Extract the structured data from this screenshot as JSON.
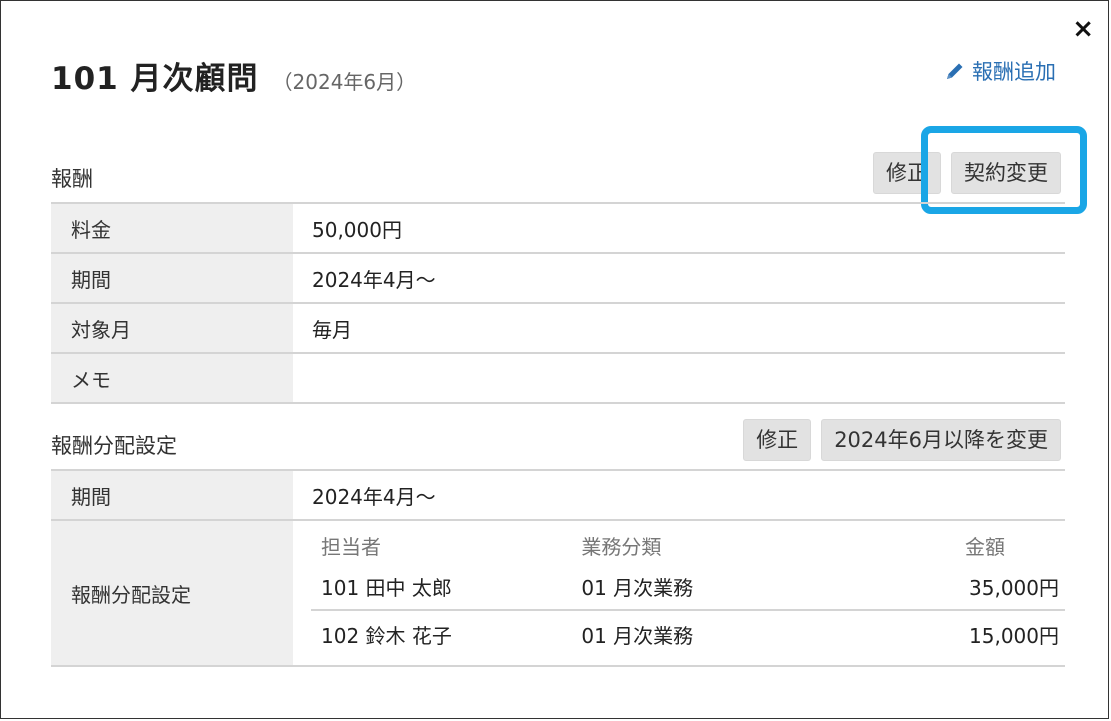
{
  "dialog": {
    "close_label": "×",
    "title": "101 月次顧問",
    "subtitle": "（2024年6月）",
    "add_link_label": "報酬追加"
  },
  "fee_section": {
    "title": "報酬",
    "edit_label": "修正",
    "change_contract_label": "契約変更",
    "rows": [
      {
        "label": "料金",
        "value": "50,000円"
      },
      {
        "label": "期間",
        "value": "2024年4月～"
      },
      {
        "label": "対象月",
        "value": "毎月"
      },
      {
        "label": "メモ",
        "value": ""
      }
    ]
  },
  "allocation_section": {
    "title": "報酬分配設定",
    "edit_label": "修正",
    "change_after_label": "2024年6月以降を変更",
    "period_label": "期間",
    "period_value": "2024年4月～",
    "settings_label": "報酬分配設定",
    "columns": [
      "担当者",
      "業務分類",
      "金額"
    ],
    "rows": [
      {
        "person": "101 田中 太郎",
        "category": "01 月次業務",
        "amount": "35,000円"
      },
      {
        "person": "102 鈴木 花子",
        "category": "01 月次業務",
        "amount": "15,000円"
      }
    ]
  },
  "colors": {
    "highlight": "#1aa6e6",
    "link": "#2a6fb3",
    "button_bg": "#e2e2e2",
    "label_bg": "#efefef"
  },
  "icons": {
    "add": "pencil-icon",
    "close": "close-icon"
  }
}
